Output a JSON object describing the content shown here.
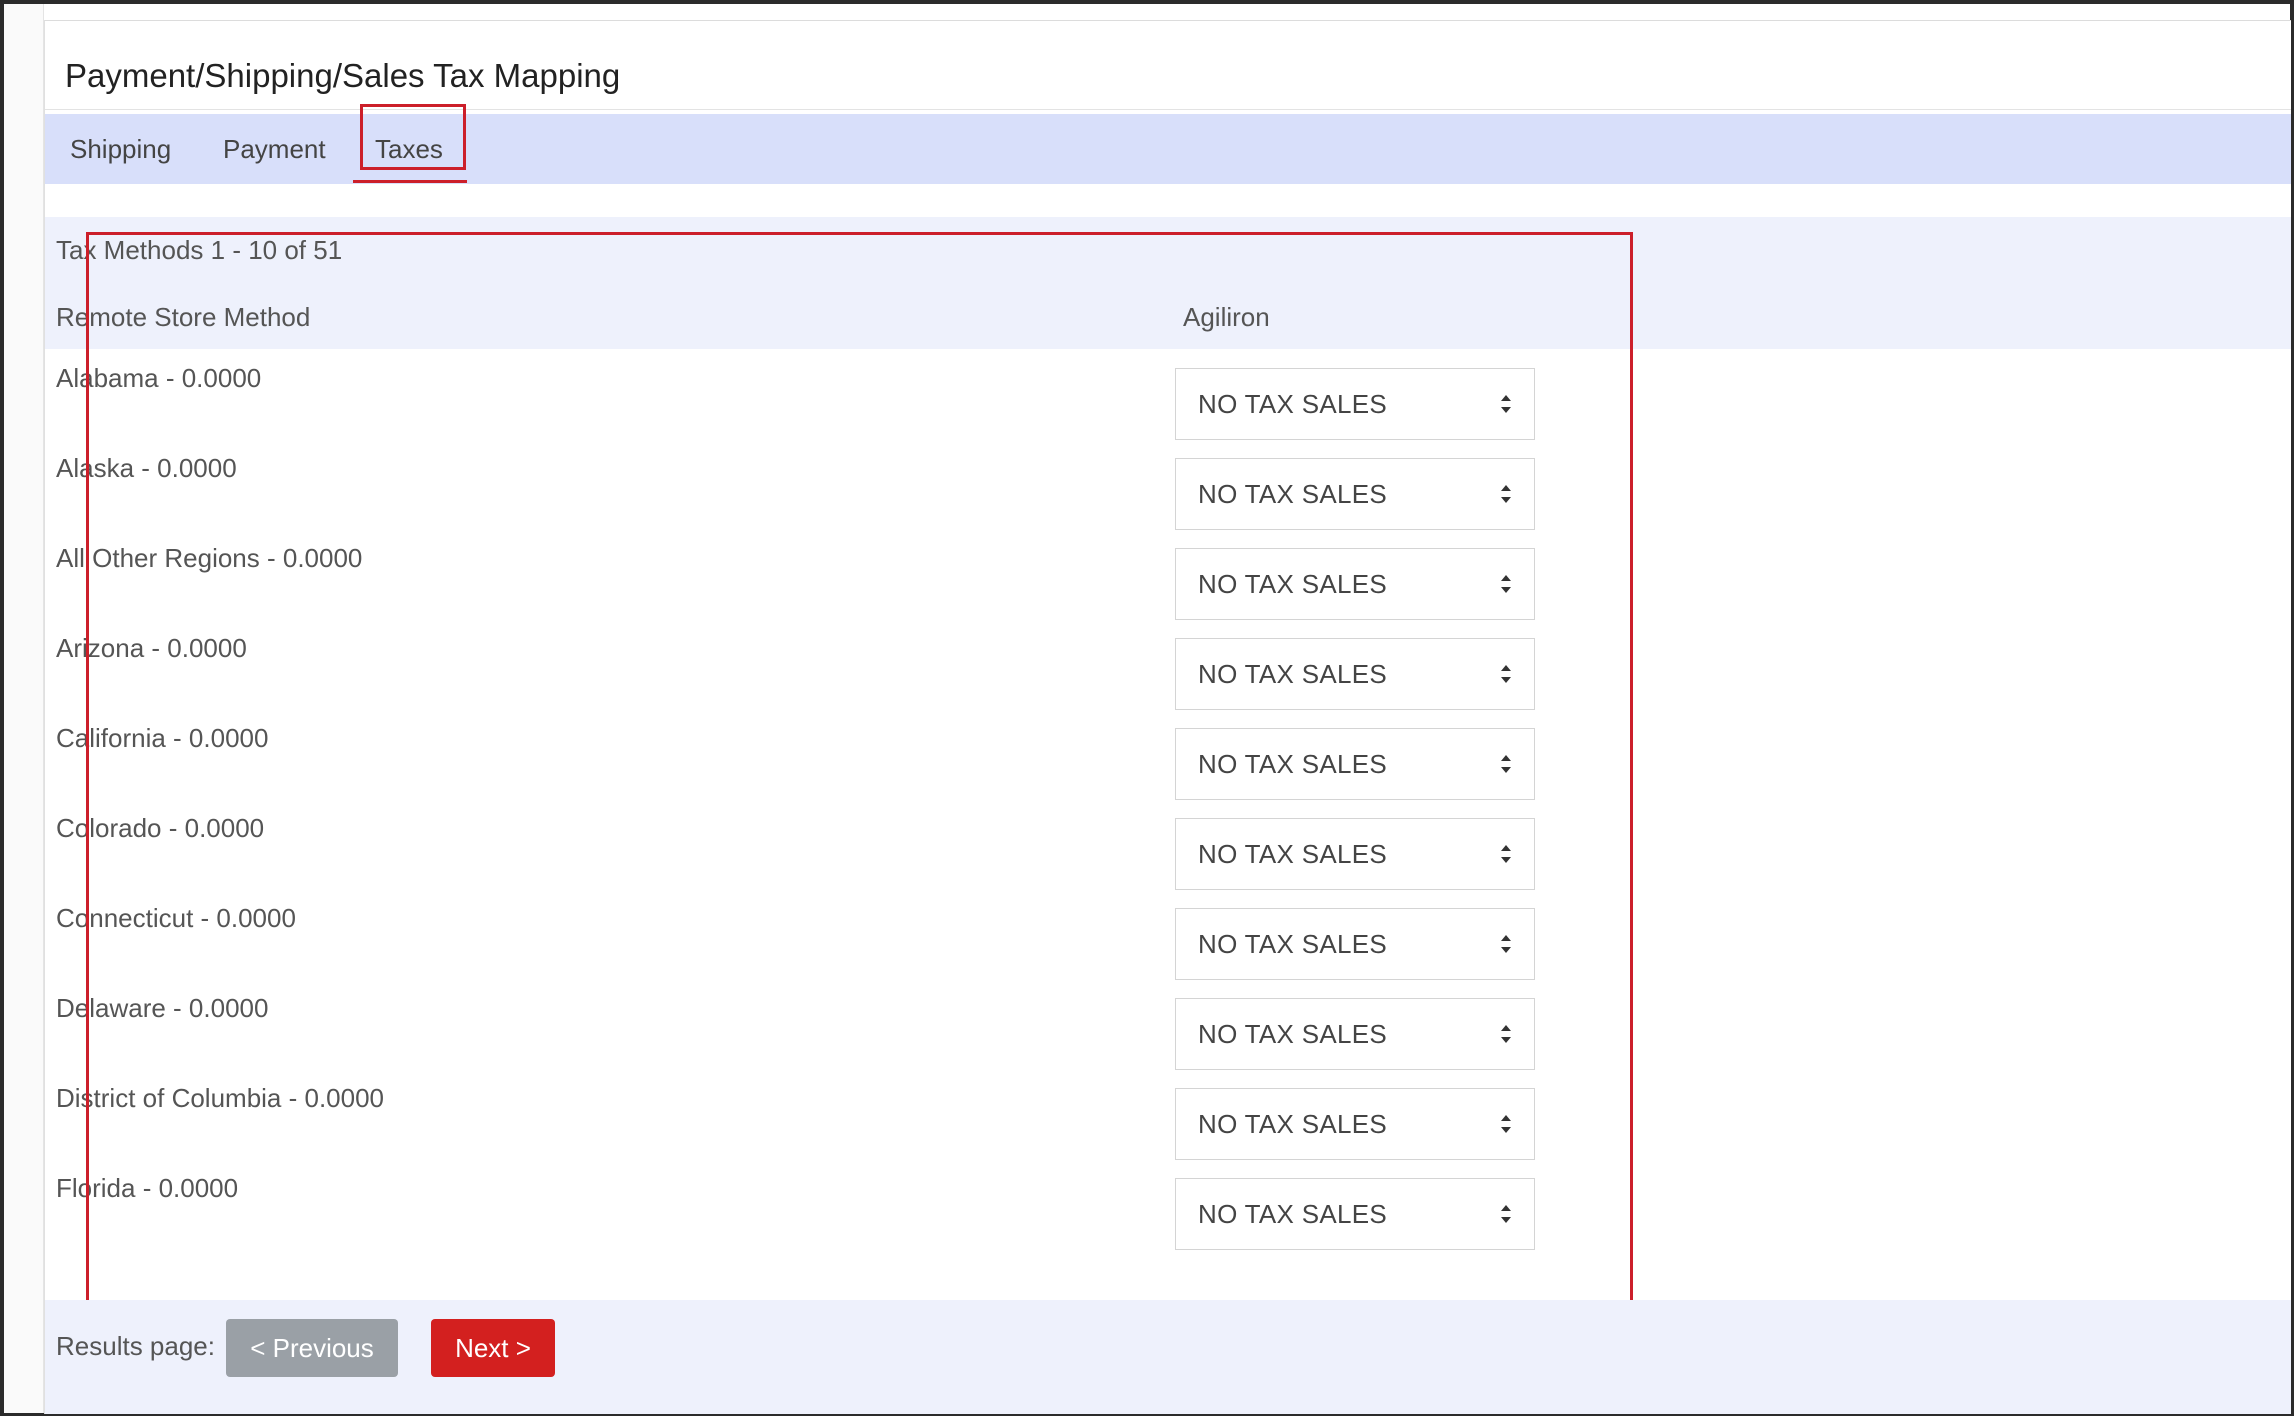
{
  "page": {
    "title": "Payment/Shipping/Sales Tax Mapping"
  },
  "tabs": [
    {
      "label": "Shipping"
    },
    {
      "label": "Payment"
    },
    {
      "label": "Taxes",
      "active": true
    }
  ],
  "tax_methods": {
    "count_text": "Tax Methods 1 - 10 of 51",
    "columns": {
      "remote": "Remote Store Method",
      "agiliron": "Agiliron"
    },
    "rows": [
      {
        "label": "Alabama - 0.0000",
        "selected": "NO TAX SALES"
      },
      {
        "label": "Alaska - 0.0000",
        "selected": "NO TAX SALES"
      },
      {
        "label": "All Other Regions - 0.0000",
        "selected": "NO TAX SALES"
      },
      {
        "label": "Arizona - 0.0000",
        "selected": "NO TAX SALES"
      },
      {
        "label": "California - 0.0000",
        "selected": "NO TAX SALES"
      },
      {
        "label": "Colorado - 0.0000",
        "selected": "NO TAX SALES"
      },
      {
        "label": "Connecticut - 0.0000",
        "selected": "NO TAX SALES"
      },
      {
        "label": "Delaware - 0.0000",
        "selected": "NO TAX SALES"
      },
      {
        "label": "District of Columbia - 0.0000",
        "selected": "NO TAX SALES"
      },
      {
        "label": "Florida - 0.0000",
        "selected": "NO TAX SALES"
      }
    ]
  },
  "pagination": {
    "label": "Results page:",
    "previous_label": "< Previous",
    "next_label": "Next >"
  },
  "colors": {
    "accent": "#cc1f2a",
    "tab_bar": "#d8dffa",
    "band": "#eef1fc",
    "next_button": "#d3201f",
    "previous_button": "#9aa0a6"
  },
  "icons": {
    "select_arrows": "sort-arrows-icon"
  }
}
